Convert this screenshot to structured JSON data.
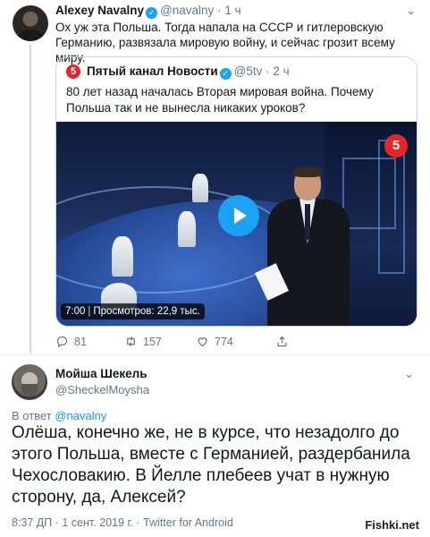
{
  "tweet": {
    "name": "Alexey Navalny",
    "handle": "@navalny",
    "time": "1 ч",
    "text": "Ох уж эта Польша. Тогда напала на СССР и гитлеровскую Германию, развязала мировую войну, и сейчас грозит всему миру.",
    "quoted": {
      "name": "Пятый канал Новости",
      "handle": "@5tv",
      "time": "2 ч",
      "text": "80 лет назад началась Вторая мировая война. Почему Польша так и не вынесла никаких уроков?",
      "video": {
        "duration": "7:00",
        "views": "Просмотров: 22,9 тыс.",
        "channel_logo": "5"
      }
    },
    "actions": {
      "replies": "81",
      "retweets": "157",
      "likes": "774"
    }
  },
  "reply": {
    "name": "Мойша Шекель",
    "handle": "@SheckelMoysha",
    "in_reply_prefix": "В ответ",
    "in_reply_handle": "@navalny",
    "text": "Олёша, конечно же, не в курсе, что незадолго до этого Польша, вместе с Германией, раздербанила Чехословакию. В Йелле плебеев учат в нужную сторону, да, Алексей?",
    "meta": "8:37 ДП · 1 сент. 2019 г. · Twitter for Android"
  },
  "watermark": "Fishki.net",
  "colors": {
    "accent": "#1da1f2",
    "muted": "#657786",
    "channel_red": "#e3262b"
  },
  "icons": [
    "chevron-down-icon",
    "verified-icon",
    "play-icon",
    "reply-icon",
    "retweet-icon",
    "like-icon",
    "share-icon"
  ]
}
